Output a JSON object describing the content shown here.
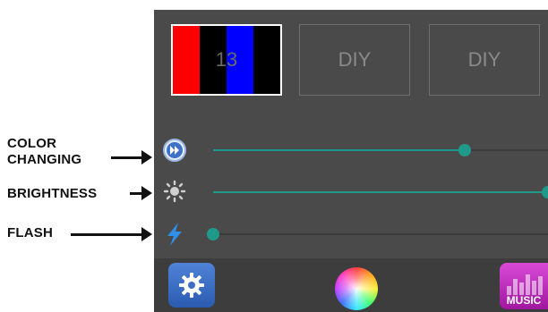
{
  "presets": [
    {
      "label": "13",
      "active": true,
      "stripes": [
        "#ff0000",
        "#000000",
        "#0000ff",
        "#000000"
      ]
    },
    {
      "label": "DIY",
      "active": false
    },
    {
      "label": "DIY",
      "active": false
    }
  ],
  "sliders": {
    "color_changing": {
      "value": 0.75,
      "icon": "fast-forward-icon"
    },
    "brightness": {
      "value": 1.0,
      "icon": "brightness-icon"
    },
    "flash": {
      "value": 0.0,
      "icon": "lightning-icon"
    }
  },
  "annotations": {
    "color_changing_line1": "COLOR",
    "color_changing_line2": "CHANGING",
    "brightness": "BRIGHTNESS",
    "flash": "FLASH"
  },
  "bottom_bar": {
    "settings_icon": "gear-icon",
    "color_wheel_icon": "color-wheel-icon",
    "music_label": "MUSIC"
  },
  "colors": {
    "panel": "#4a4a4a",
    "accent": "#1f9a8a"
  }
}
